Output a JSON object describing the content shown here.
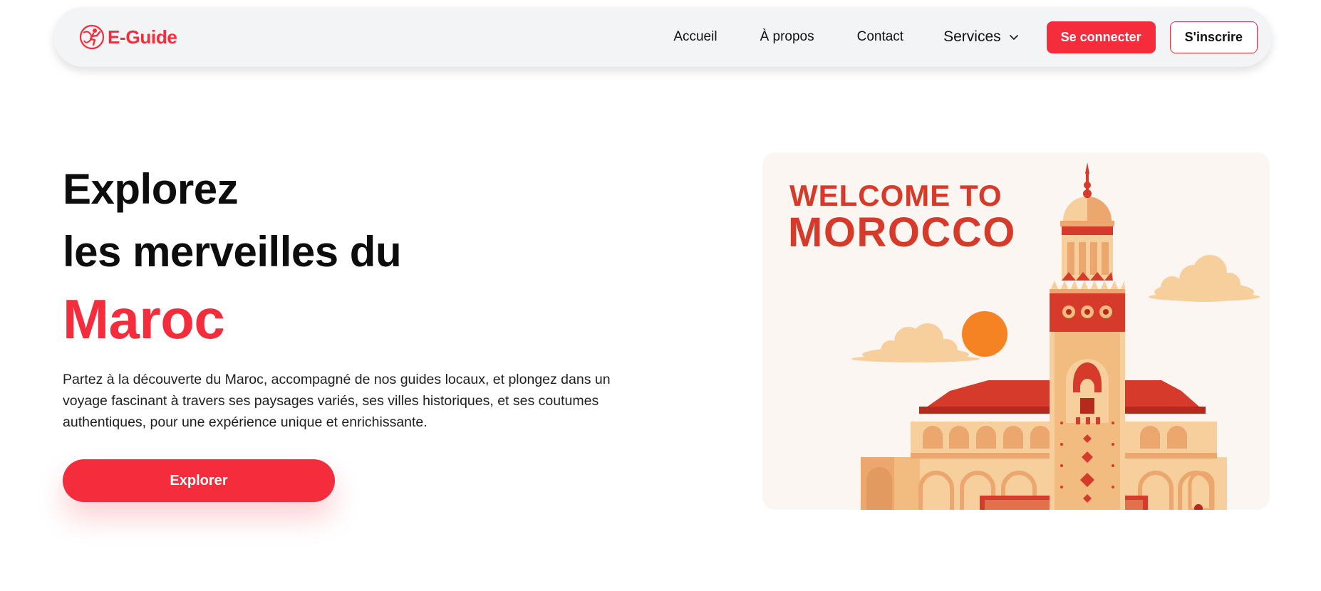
{
  "brand": {
    "name": "E-Guide",
    "icon": "guide-logo-icon",
    "color": "#f52c3b"
  },
  "nav": {
    "links": [
      "Accueil",
      "À propos",
      "Contact"
    ],
    "services_label": "Services",
    "services_icon": "chevron-down-icon",
    "login_label": "Se connecter",
    "signup_label": "S'inscrire"
  },
  "hero": {
    "title_line1": "Explorez",
    "title_line2": "les merveilles du",
    "title_accent": "Maroc",
    "description": "Partez à la découverte du Maroc, accompagné de nos guides locaux, et plongez dans un voyage fascinant à travers ses paysages variés, ses villes historiques, et ses coutumes authentiques, pour une expérience unique et enrichissante.",
    "cta_label": "Explorer"
  },
  "illustration": {
    "welcome_line1": "WELCOME TO",
    "welcome_line2": "MOROCCO"
  },
  "colors": {
    "accent": "#f52c3b",
    "nav_bg": "#f3f4f6",
    "illustration_red": "#d63a2a",
    "sand": "#f7cf9d",
    "sun": "#f58223"
  }
}
